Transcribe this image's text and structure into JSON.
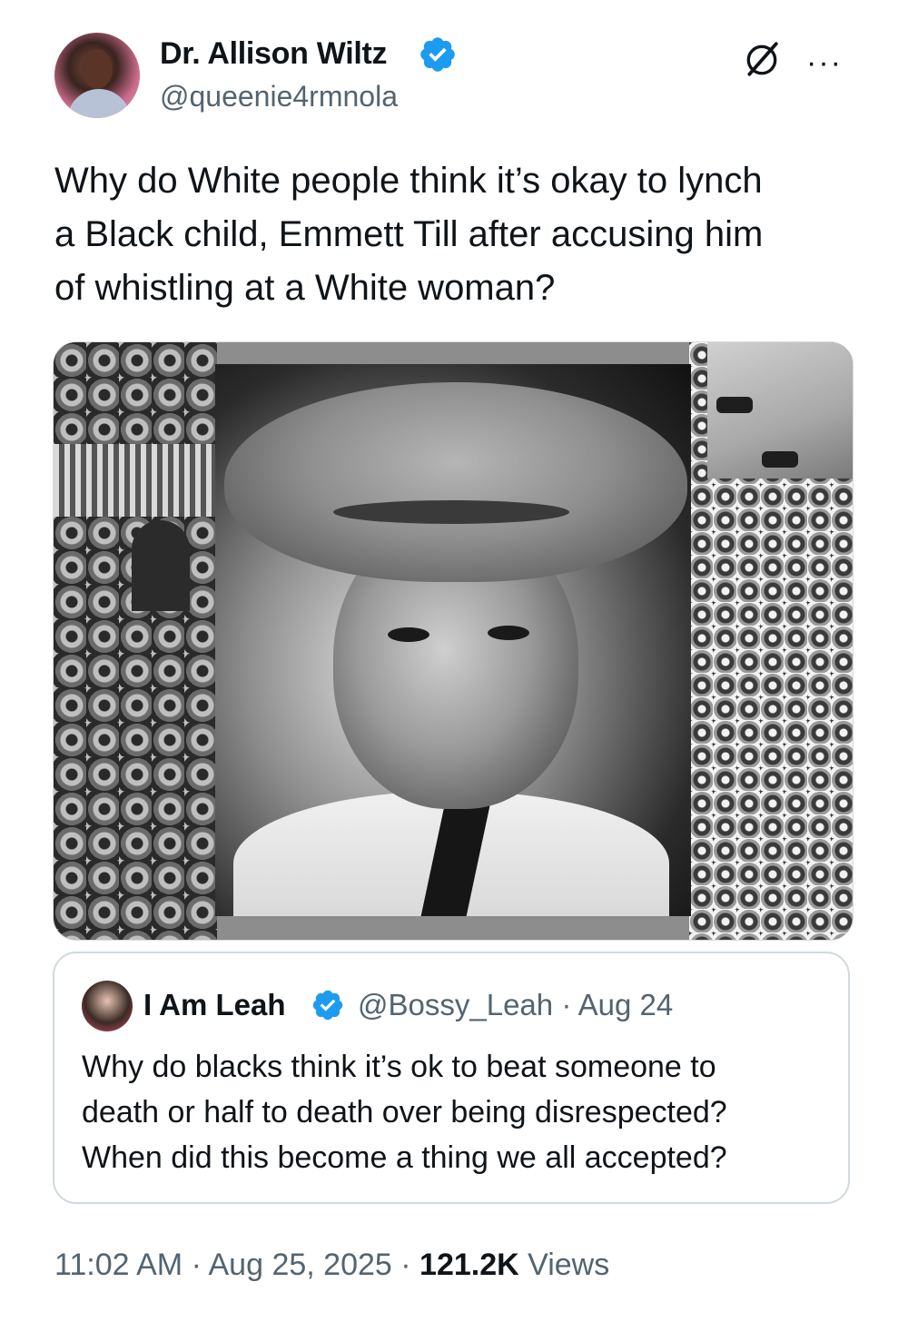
{
  "tweet": {
    "author": {
      "name": "Dr. Allison Wiltz",
      "handle": "@queenie4rmnola",
      "verified": true
    },
    "text_lines": [
      "Why do White people think it’s okay to lynch",
      "a Black child, Emmett Till after accusing him",
      "of whistling at a White woman?"
    ],
    "media": {
      "description_icon": "photo-collage"
    },
    "quoted": {
      "name": "I Am Leah",
      "handle": "@Bossy_Leah",
      "separator": "·",
      "date": "Aug 24",
      "verified": true,
      "text_lines": [
        "Why do blacks think it’s ok to beat someone to",
        "death or half to death over being disrespected?",
        "When did this become a thing we all accepted?"
      ]
    },
    "footer": {
      "time": "11:02 AM",
      "dot1": "·",
      "date": "Aug 25, 2025",
      "dot2": "·",
      "views_count": "121.2K",
      "views_label": "Views"
    }
  },
  "icons": {
    "verified": "verified-badge-icon",
    "grok": "grok-icon",
    "more": "more-options-icon"
  },
  "colors": {
    "text_primary": "#0f1419",
    "text_secondary": "#536471",
    "verified_blue": "#1d9bf0",
    "border": "#cfd9de"
  }
}
